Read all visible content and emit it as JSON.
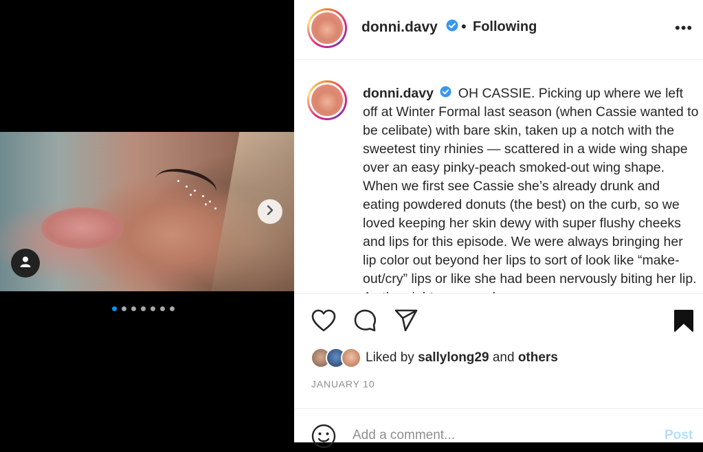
{
  "post": {
    "author": "donni.davy",
    "follow_status": "Following",
    "separator": "•",
    "more_label": "•••",
    "caption_username": "donni.davy",
    "caption": "OH CASSIE. Picking up where we left off at Winter Formal last season (when Cassie wanted to be celibate) with bare skin, taken up a notch with the sweetest tiny rhinies — scattered in a wide wing shape over an easy pinky-peach smoked-out wing shape. When we first see Cassie she’s already drunk and eating powdered donuts (the best) on the curb, so we loved keeping her skin dewy with super flushy cheeks and lips for this episode. We were always bringing her lip color out beyond her lips to sort of look like “make-out/cry” lips or like she had been nervously biting her lip. As the night goes on, h",
    "liked_by_prefix": "Liked by",
    "liked_by_user": "sallylong29",
    "liked_by_and": "and",
    "liked_by_others": "others",
    "date": "JANUARY 10"
  },
  "carousel": {
    "total_slides": 7,
    "active_slide": 1
  },
  "comment": {
    "placeholder": "Add a comment...",
    "post_label": "Post"
  },
  "colors": {
    "verified": "#3897f0",
    "active_dot": "#0095f6",
    "post_disabled": "#b2dffc"
  },
  "icons": [
    "chevron-right-icon",
    "user-tag-icon",
    "heart-icon",
    "comment-icon",
    "share-icon",
    "bookmark-icon",
    "emoji-icon",
    "verified-icon",
    "more-icon"
  ]
}
